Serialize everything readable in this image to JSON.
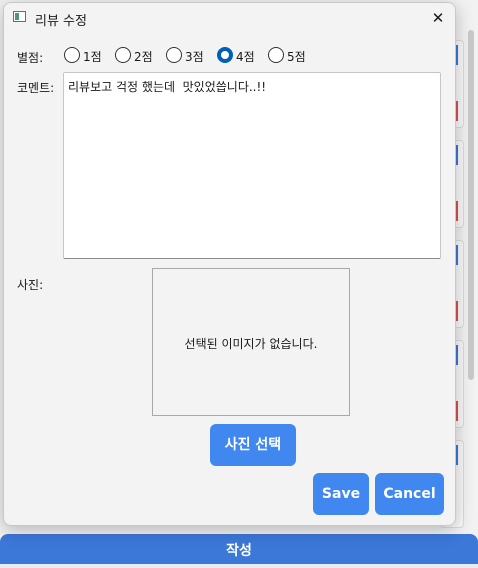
{
  "dialog": {
    "title": "리뷰 수정",
    "close_icon": "✕"
  },
  "rating": {
    "label": "별점:",
    "options": [
      "1점",
      "2점",
      "3점",
      "4점",
      "5점"
    ],
    "selected": "4점"
  },
  "comment": {
    "label": "코멘트:",
    "value": "리뷰보고 걱정 했는데  맛있었씁니다..!!"
  },
  "photo": {
    "label": "사진:",
    "empty_text": "선택된 이미지가 없습니다.",
    "select_button": "사진 선택"
  },
  "actions": {
    "save": "Save",
    "cancel": "Cancel"
  },
  "background": {
    "bottom_button": "작성"
  },
  "colors": {
    "primary": "#4088f0",
    "radio_checked": "#005fb8"
  }
}
